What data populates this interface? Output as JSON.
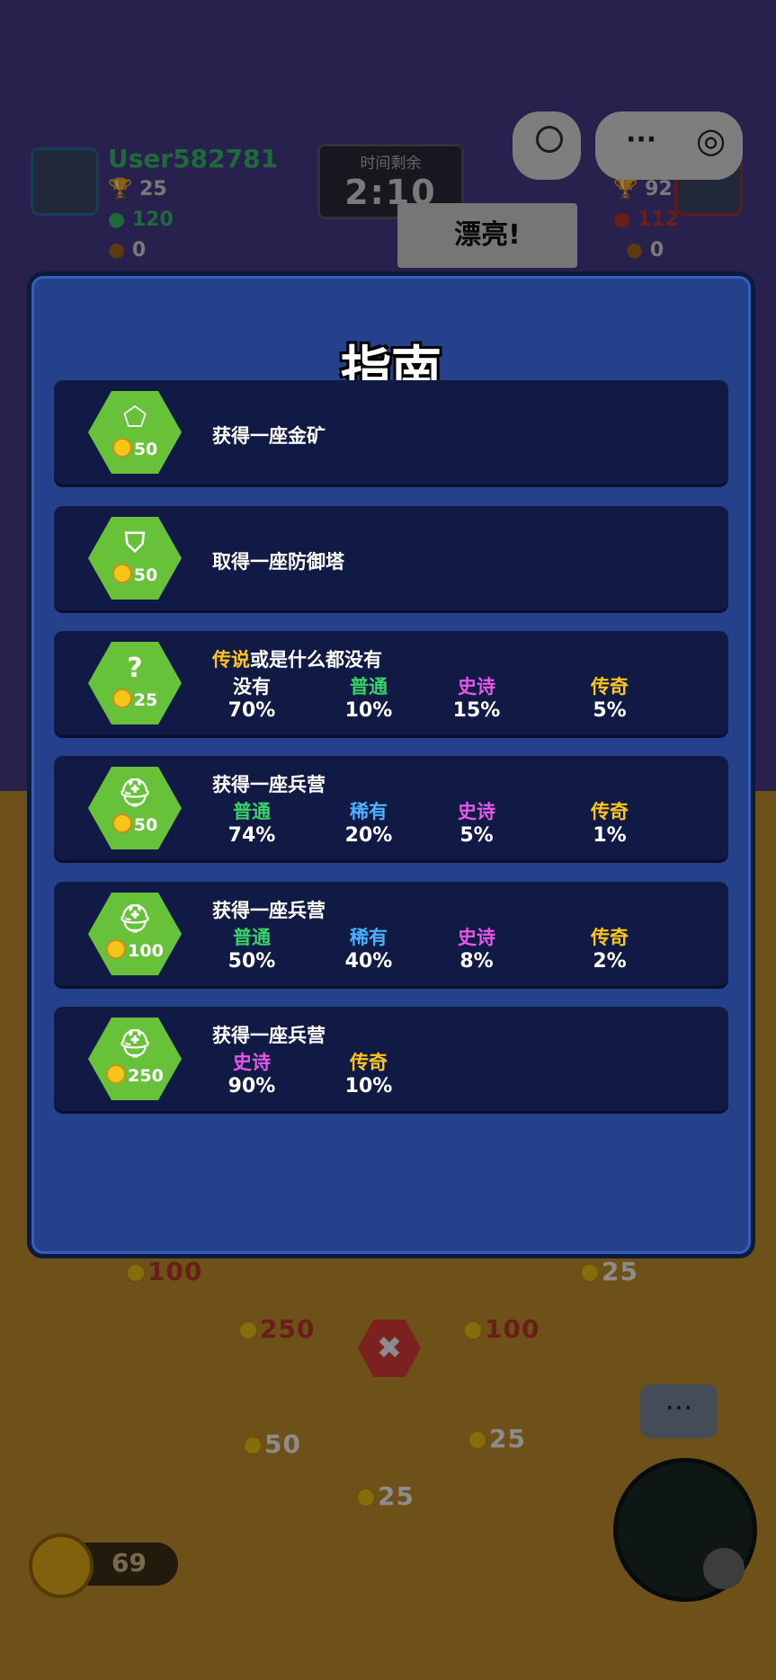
{
  "hud": {
    "player_name": "User582781",
    "player_trophies": "25",
    "player_gems": "120",
    "player_acorns": "0",
    "timer_label": "时间剩余",
    "timer_value": "2:10",
    "opponent_trophies": "92",
    "opponent_gems": "112",
    "opponent_acorns": "0",
    "toast": "漂亮!",
    "more_menu_icon": "···",
    "record_icon": "◎"
  },
  "guide": {
    "title": "指南",
    "items": [
      {
        "icon": "gold-mine-icon",
        "glyph": "⬠",
        "price": "50",
        "title": "获得一座金矿",
        "rates": []
      },
      {
        "icon": "shield-icon",
        "glyph": "⛉",
        "price": "50",
        "title": "取得一座防御塔",
        "rates": []
      },
      {
        "icon": "question-icon",
        "glyph": "?",
        "price": "25",
        "title_highlight": "传说",
        "title": "或是什么都没有",
        "rates": [
          {
            "name": "没有",
            "value": "70%",
            "color": "#ffffff"
          },
          {
            "name": "普通",
            "value": "10%",
            "color": "#38d36a"
          },
          {
            "name": "史诗",
            "value": "15%",
            "color": "#e457e8"
          },
          {
            "name": "传奇",
            "value": "5%",
            "color": "#ffc61a"
          }
        ]
      },
      {
        "icon": "helmet-icon",
        "glyph": "⛑",
        "price": "50",
        "title": "获得一座兵营",
        "rates": [
          {
            "name": "普通",
            "value": "74%",
            "color": "#38d36a"
          },
          {
            "name": "稀有",
            "value": "20%",
            "color": "#4ab0ff"
          },
          {
            "name": "史诗",
            "value": "5%",
            "color": "#e457e8"
          },
          {
            "name": "传奇",
            "value": "1%",
            "color": "#ffc61a"
          }
        ]
      },
      {
        "icon": "helmet-icon",
        "glyph": "⛑",
        "price": "100",
        "title": "获得一座兵营",
        "rates": [
          {
            "name": "普通",
            "value": "50%",
            "color": "#38d36a"
          },
          {
            "name": "稀有",
            "value": "40%",
            "color": "#4ab0ff"
          },
          {
            "name": "史诗",
            "value": "8%",
            "color": "#e457e8"
          },
          {
            "name": "传奇",
            "value": "2%",
            "color": "#ffc61a"
          }
        ]
      },
      {
        "icon": "helmet-icon",
        "glyph": "⛑",
        "price": "250",
        "title": "获得一座兵营",
        "rates": [
          {
            "name": "史诗",
            "value": "90%",
            "color": "#e457e8"
          },
          {
            "name": "传奇",
            "value": "10%",
            "color": "#ffc61a"
          }
        ]
      }
    ]
  },
  "board": {
    "prices": [
      "100",
      "25",
      "250",
      "100",
      "50",
      "25",
      "25"
    ],
    "close_icon": "✖",
    "chat_icon": "···"
  },
  "footer": {
    "coins": "69"
  }
}
